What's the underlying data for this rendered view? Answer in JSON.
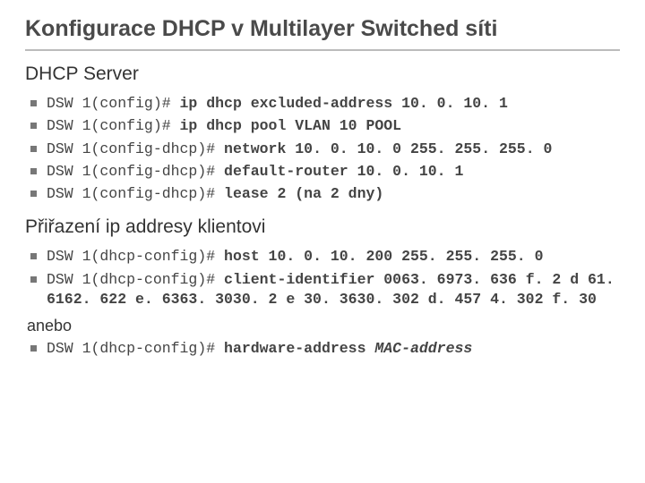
{
  "title": "Konfigurace DHCP v Multilayer Switched síti",
  "section1": {
    "heading": "DHCP Server",
    "items": [
      {
        "prompt": "DSW 1(config)# ",
        "cmd": "ip dhcp excluded-address 10. 0. 10. 1"
      },
      {
        "prompt": "DSW 1(config)# ",
        "cmd": "ip dhcp pool VLAN 10 POOL"
      },
      {
        "prompt": "DSW 1(config-dhcp)# ",
        "cmd": "network 10. 0. 10. 0 255. 255. 255. 0"
      },
      {
        "prompt": "DSW 1(config-dhcp)# ",
        "cmd": "default-router 10. 0. 10. 1"
      },
      {
        "prompt": "DSW 1(config-dhcp)# ",
        "cmd": "lease 2 (na 2 dny)"
      }
    ]
  },
  "section2": {
    "heading": "Přiřazení ip addresy klientovi",
    "items": [
      {
        "prompt": "DSW 1(dhcp-config)# ",
        "cmd": "host 10. 0. 10. 200 255. 255. 255. 0"
      },
      {
        "prompt": "DSW 1(dhcp-config)# ",
        "cmd": "client-identifier 0063. 6973. 636 f. 2 d 61. 6162. 622 e. 6363. 3030. 2 e 30. 3630. 302 d. 457 4. 302 f. 30"
      }
    ],
    "or_label": "anebo",
    "item_hw": {
      "prompt": "DSW 1(dhcp-config)# ",
      "cmd": "hardware-address ",
      "arg": "MAC-address"
    }
  }
}
